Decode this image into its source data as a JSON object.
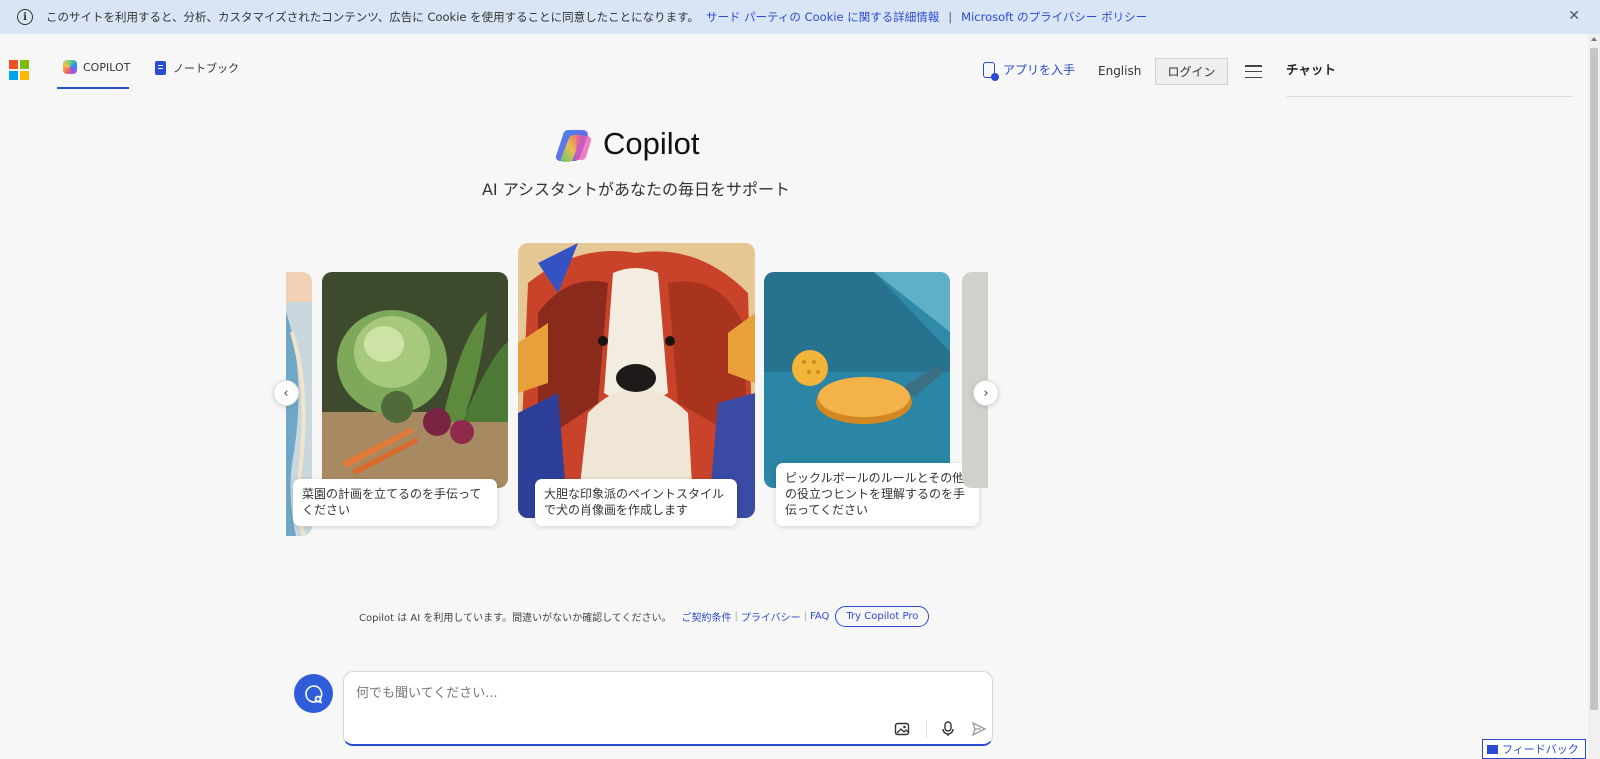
{
  "cookie_banner": {
    "text": "このサイトを利用すると、分析、カスタマイズされたコンテンツ、広告に Cookie を使用することに同意したことになります。",
    "link1": "サード パーティの Cookie に関する詳細情報",
    "separator": "|",
    "link2": "Microsoft のプライバシー ポリシー",
    "close": "✕"
  },
  "header": {
    "tabs": [
      {
        "label": "COPILOT",
        "active": true
      },
      {
        "label": "ノートブック",
        "active": false
      }
    ],
    "get_app": "アプリを入手",
    "language": "English",
    "login": "ログイン"
  },
  "side_panel": {
    "title": "チャット"
  },
  "hero": {
    "title": "Copilot",
    "subtitle": "AI アシスタントがあなたの毎日をサポート"
  },
  "carousel": {
    "cards": [
      {
        "caption": "菜園の計画を立てるのを手伝ってください"
      },
      {
        "caption": "大胆な印象派のペイントスタイルで犬の肖像画を作成します"
      },
      {
        "caption": "ピックルボールのルールとその他の役立つヒントを理解するのを手伝ってください"
      }
    ],
    "prev": "‹",
    "next": "›"
  },
  "disclaimer": {
    "text": "Copilot は AI を利用しています。間違いがないか確認してください。",
    "terms": "ご契約条件",
    "privacy": "プライバシー",
    "faq": "FAQ",
    "try_pro": "Try Copilot Pro"
  },
  "chat_input": {
    "placeholder": "何でも聞いてください..."
  },
  "feedback": "フィードバック",
  "colors": {
    "accent": "#2b4bd1",
    "banner_bg": "#d9e5f5",
    "page_bg": "#f7f7f7"
  }
}
